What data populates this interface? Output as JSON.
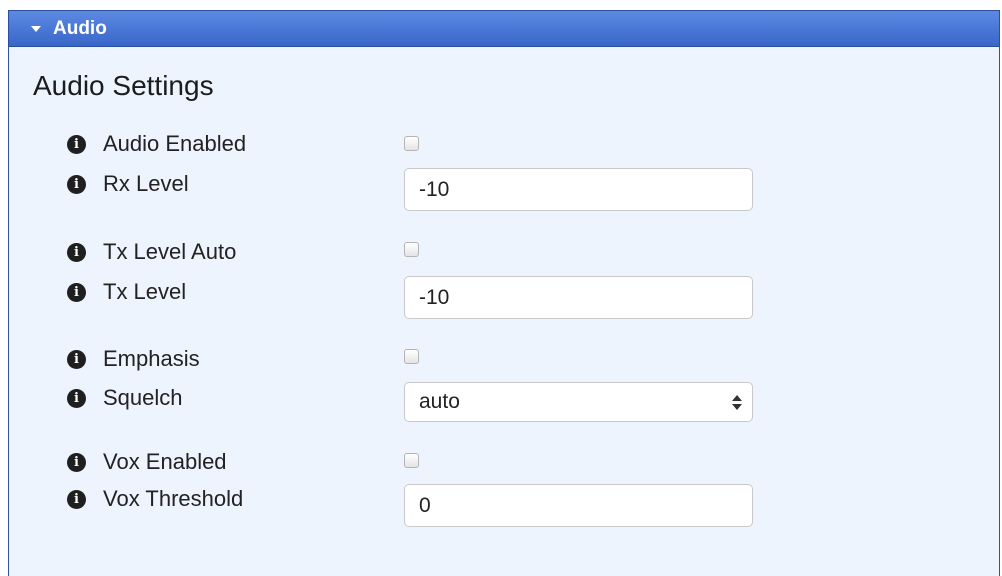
{
  "panel": {
    "title": "Audio"
  },
  "section": {
    "title": "Audio Settings"
  },
  "icons": {
    "info_glyph": "i",
    "info_icon_name": "info-circle-icon"
  },
  "fields": {
    "audio_enabled": {
      "label": "Audio Enabled",
      "checked": false
    },
    "rx_level": {
      "label": "Rx Level",
      "value": "-10"
    },
    "tx_level_auto": {
      "label": "Tx Level Auto",
      "checked": false
    },
    "tx_level": {
      "label": "Tx Level",
      "value": "-10"
    },
    "emphasis": {
      "label": "Emphasis",
      "checked": false
    },
    "squelch": {
      "label": "Squelch",
      "value": "auto"
    },
    "vox_enabled": {
      "label": "Vox Enabled",
      "checked": false
    },
    "vox_threshold": {
      "label": "Vox Threshold",
      "value": "0"
    }
  },
  "colors": {
    "header_top": "#5b8ae2",
    "header_bottom": "#3a66c9",
    "panel_background": "#edf4fd"
  }
}
